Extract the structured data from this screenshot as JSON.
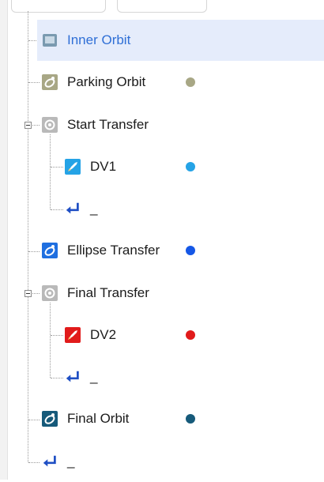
{
  "tree": {
    "nodes": [
      {
        "key": "inner",
        "label": "Inner Orbit",
        "icon": "flag-icon",
        "selected": true
      },
      {
        "key": "parking",
        "label": "Parking Orbit",
        "icon": "orbit-icon",
        "dot_color": "#a8a785"
      },
      {
        "key": "start",
        "label": "Start Transfer",
        "icon": "target-icon",
        "expanded": true
      },
      {
        "key": "dv1",
        "label": "DV1",
        "icon": "rocket-icon",
        "dot_color": "#25a3e6"
      },
      {
        "key": "ret1",
        "label": "_",
        "icon": "return-arrow-icon"
      },
      {
        "key": "ellipse",
        "label": "Ellipse Transfer",
        "icon": "orbit-icon",
        "dot_color": "#1557e6"
      },
      {
        "key": "final_tr",
        "label": "Final Transfer",
        "icon": "target-icon",
        "expanded": true
      },
      {
        "key": "dv2",
        "label": "DV2",
        "icon": "rocket-icon",
        "dot_color": "#e11b1b"
      },
      {
        "key": "ret2",
        "label": "_",
        "icon": "return-arrow-icon"
      },
      {
        "key": "final_orbit",
        "label": "Final Orbit",
        "icon": "orbit-icon",
        "dot_color": "#165a7a"
      },
      {
        "key": "ret3",
        "label": "_",
        "icon": "return-arrow-icon"
      }
    ]
  }
}
